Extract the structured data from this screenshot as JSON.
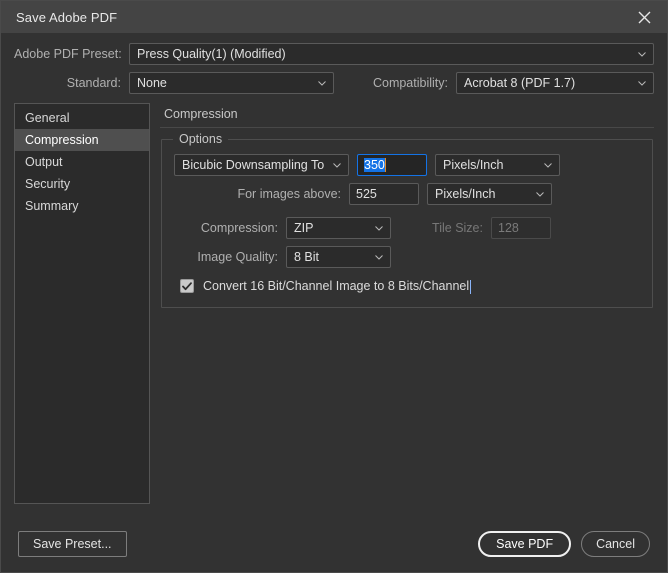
{
  "window": {
    "title": "Save Adobe PDF",
    "close_icon": "close-icon"
  },
  "header": {
    "preset_label": "Adobe PDF Preset:",
    "preset_value": "Press Quality(1) (Modified)",
    "standard_label": "Standard:",
    "standard_value": "None",
    "compatibility_label": "Compatibility:",
    "compatibility_value": "Acrobat 8 (PDF 1.7)"
  },
  "sidebar": {
    "items": [
      {
        "label": "General",
        "selected": false
      },
      {
        "label": "Compression",
        "selected": true
      },
      {
        "label": "Output",
        "selected": false
      },
      {
        "label": "Security",
        "selected": false
      },
      {
        "label": "Summary",
        "selected": false
      }
    ]
  },
  "panel": {
    "title": "Compression",
    "group_legend": "Options",
    "downsample_method": "Bicubic Downsampling To",
    "downsample_value": "350",
    "downsample_unit": "Pixels/Inch",
    "for_images_above_label": "For images above:",
    "for_images_above_value": "525",
    "for_images_above_unit": "Pixels/Inch",
    "compression_label": "Compression:",
    "compression_value": "ZIP",
    "tile_size_label": "Tile Size:",
    "tile_size_value": "128",
    "image_quality_label": "Image Quality:",
    "image_quality_value": "8 Bit",
    "convert_checkbox_label": "Convert 16 Bit/Channel Image to 8 Bits/Channel",
    "convert_checkbox_checked": true
  },
  "footer": {
    "save_preset_label": "Save Preset...",
    "save_pdf_label": "Save PDF",
    "cancel_label": "Cancel"
  },
  "colors": {
    "accent_selection": "#1473e6",
    "window_bg": "#323232",
    "titlebar_bg": "#444444",
    "field_bg": "#2b2b2b",
    "sidebar_selected": "#4f4f4f",
    "text_cursor": "#e08b2a"
  }
}
